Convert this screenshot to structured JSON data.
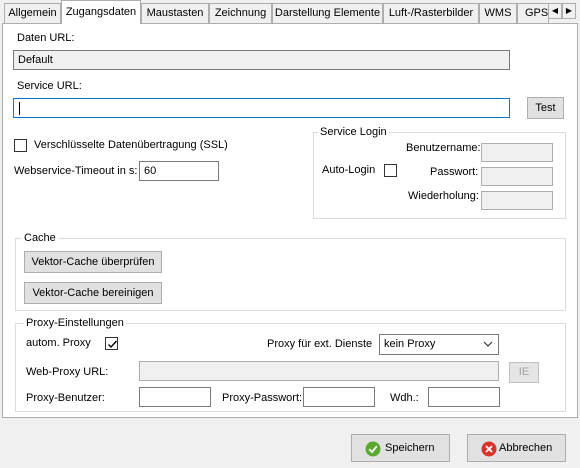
{
  "tabs": [
    {
      "label": "Allgemein",
      "active": false
    },
    {
      "label": "Zugangsdaten",
      "active": true
    },
    {
      "label": "Maustasten",
      "active": false
    },
    {
      "label": "Zeichnung",
      "active": false
    },
    {
      "label": "Darstellung Elemente",
      "active": false
    },
    {
      "label": "Luft-/Rasterbilder",
      "active": false
    },
    {
      "label": "WMS",
      "active": false
    },
    {
      "label": "GPS",
      "active": false
    }
  ],
  "data_url": {
    "label": "Daten URL:",
    "value": "Default"
  },
  "service_url": {
    "label": "Service URL:",
    "value": "",
    "test_button": "Test"
  },
  "ssl": {
    "label": "Verschlüsselte Datenübertragung (SSL)",
    "checked": false
  },
  "timeout": {
    "label": "Webservice-Timeout in s:",
    "value": "60"
  },
  "service_login": {
    "title": "Service Login",
    "username_label": "Benutzername:",
    "auto_login_label": "Auto-Login",
    "auto_login_checked": false,
    "password_label": "Passwort:",
    "repeat_label": "Wiederholung:"
  },
  "cache": {
    "title": "Cache",
    "check_button": "Vektor-Cache überprüfen",
    "clean_button": "Vektor-Cache bereinigen"
  },
  "proxy": {
    "title": "Proxy-Einstellungen",
    "auto_label": "autom. Proxy",
    "auto_checked": true,
    "ext_label": "Proxy für ext. Dienste",
    "ext_selected": "kein Proxy",
    "web_proxy_label": "Web-Proxy URL:",
    "ie_button": "IE",
    "user_label": "Proxy-Benutzer:",
    "password_label": "Proxy-Passwort:",
    "repeat_label": "Wdh.:"
  },
  "footer": {
    "save": "Speichern",
    "cancel": "Abbrechen"
  },
  "colors": {
    "save_icon": "#5aa832",
    "cancel_icon": "#d9342b",
    "focus": "#0078d7"
  }
}
